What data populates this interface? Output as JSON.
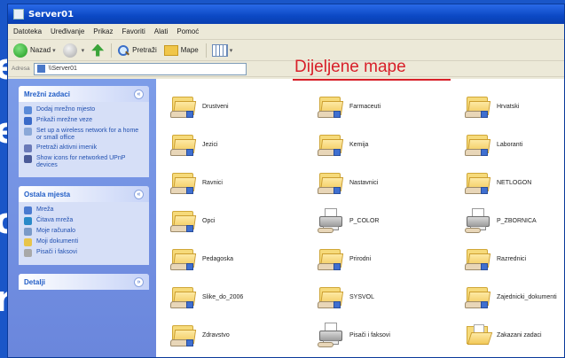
{
  "background_letters": [
    "e",
    "e",
    "o",
    "r"
  ],
  "window": {
    "title": "Server01"
  },
  "menubar": [
    "Datoteka",
    "Uređivanje",
    "Prikaz",
    "Favoriti",
    "Alati",
    "Pomoć"
  ],
  "toolbar": {
    "back_label": "Nazad",
    "search_label": "Pretraži",
    "folders_label": "Mape"
  },
  "address": {
    "label": "Adresa",
    "value": "\\\\Server01"
  },
  "heading": "Dijeljene mape",
  "sidebar": {
    "network_tasks": {
      "title": "Mrežni zadaci",
      "items": [
        "Dodaj mrežno mjesto",
        "Prikaži mrežne veze",
        "Set up a wireless network for a home or small office",
        "Pretraži aktivni imenik",
        "Show icons for networked UPnP devices"
      ]
    },
    "other_places": {
      "title": "Ostala mjesta",
      "items": [
        "Mreža",
        "Čitava mreža",
        "Moje računalo",
        "Moji dokumenti",
        "Pisači i faksovi"
      ]
    },
    "details": {
      "title": "Detalji"
    }
  },
  "items": [
    {
      "label": "Drustveni",
      "icon": "shared-folder"
    },
    {
      "label": "Farmaceuti",
      "icon": "shared-folder"
    },
    {
      "label": "Hrvatski",
      "icon": "shared-folder"
    },
    {
      "label": "Jezici",
      "icon": "shared-folder"
    },
    {
      "label": "Kemija",
      "icon": "shared-folder"
    },
    {
      "label": "Laboranti",
      "icon": "shared-folder"
    },
    {
      "label": "Ravnici",
      "icon": "shared-folder"
    },
    {
      "label": "Nastavnici",
      "icon": "shared-folder"
    },
    {
      "label": "NETLOGON",
      "icon": "shared-folder"
    },
    {
      "label": "Opci",
      "icon": "shared-folder"
    },
    {
      "label": "P_COLOR",
      "icon": "printer"
    },
    {
      "label": "P_ZBORNICA",
      "icon": "printer"
    },
    {
      "label": "Pedagoska",
      "icon": "shared-folder"
    },
    {
      "label": "Prirodni",
      "icon": "shared-folder"
    },
    {
      "label": "Razrednici",
      "icon": "shared-folder"
    },
    {
      "label": "Slike_do_2006",
      "icon": "shared-folder"
    },
    {
      "label": "SYSVOL",
      "icon": "shared-folder"
    },
    {
      "label": "Zajednicki_dokumenti",
      "icon": "shared-folder"
    },
    {
      "label": "Zdravstvo",
      "icon": "shared-folder"
    },
    {
      "label": "Pisači i faksovi",
      "icon": "printer"
    },
    {
      "label": "Zakazani zadaci",
      "icon": "open-folder"
    }
  ],
  "colors": {
    "heading": "#d8202a",
    "titlebar": "#0b48c4",
    "sidebar": "#7c9ce8",
    "slide_background": "#1a56c8"
  }
}
